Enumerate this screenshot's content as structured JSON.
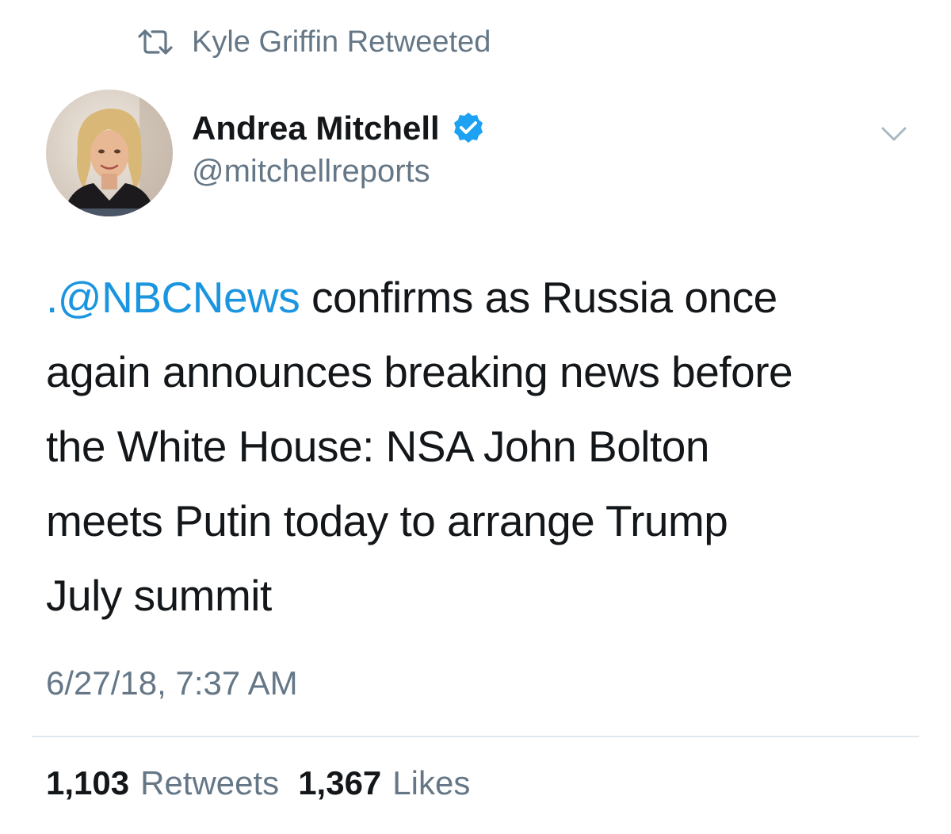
{
  "social_context": {
    "text": "Kyle Griffin Retweeted",
    "icon": "retweet-icon"
  },
  "author": {
    "name": "Andrea Mitchell",
    "handle": "@mitchellreports",
    "verified": true,
    "verified_color": "#1da1f2"
  },
  "tweet": {
    "mention": ".@NBCNews",
    "lines": [
      " confirms as Russia once",
      "again announces breaking news before",
      "the White House: NSA John Bolton",
      "meets Putin today to arrange Trump",
      "July summit"
    ],
    "timestamp": "6/27/18, 7:37 AM"
  },
  "stats": {
    "retweets_count": "1,103",
    "retweets_label": "Retweets",
    "likes_count": "1,367",
    "likes_label": "Likes"
  },
  "colors": {
    "link": "#1b95e0",
    "secondary_text": "#657786",
    "primary_text": "#14171a",
    "divider": "#e1e8ed"
  }
}
